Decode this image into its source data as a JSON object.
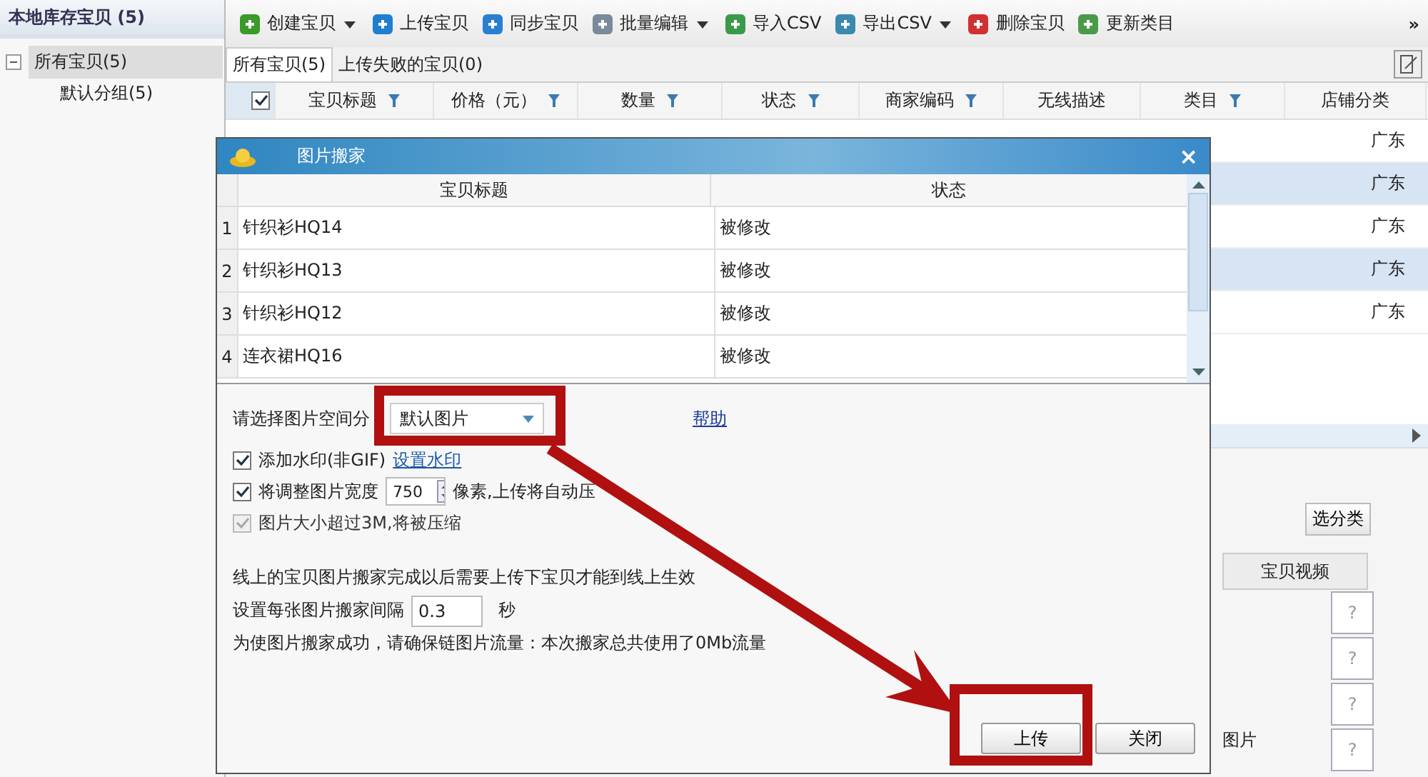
{
  "sidebar": {
    "title": "本地库存宝贝 (5)",
    "tree": [
      {
        "label": "所有宝贝(5)",
        "selected": true,
        "expanded": true,
        "children": [
          {
            "label": "默认分组(5)",
            "selected": false
          }
        ]
      }
    ]
  },
  "toolbar": {
    "items": [
      {
        "label": "创建宝贝",
        "dropdown": true
      },
      {
        "label": "上传宝贝",
        "dropdown": false
      },
      {
        "label": "同步宝贝",
        "dropdown": false
      },
      {
        "label": "批量编辑",
        "dropdown": true
      },
      {
        "label": "导入CSV",
        "dropdown": false
      },
      {
        "label": "导出CSV",
        "dropdown": true
      },
      {
        "label": "删除宝贝",
        "dropdown": false
      },
      {
        "label": "更新类目",
        "dropdown": false
      }
    ],
    "more": "»"
  },
  "tabs": [
    {
      "label": "所有宝贝(5)",
      "selected": true
    },
    {
      "label": "上传失败的宝贝(0)",
      "selected": false
    }
  ],
  "table": {
    "header_checked": true,
    "columns": [
      {
        "label": "宝贝标题",
        "filter": true
      },
      {
        "label": "价格（元）",
        "filter": true
      },
      {
        "label": "数量",
        "filter": true
      },
      {
        "label": "状态",
        "filter": true
      },
      {
        "label": "商家编码",
        "filter": true
      },
      {
        "label": "无线描述",
        "filter": false
      },
      {
        "label": "类目",
        "filter": true
      },
      {
        "label": "店铺分类",
        "filter": false
      }
    ],
    "rows": [
      {
        "column_9": "广东"
      },
      {
        "column_9": "广东"
      },
      {
        "column_9": "广东"
      },
      {
        "column_9": "广东"
      },
      {
        "column_9": "广东"
      }
    ]
  },
  "detail": {
    "category_button": "选分类",
    "media_tab": "宝贝视频",
    "image_label": "图片",
    "help_boxes": [
      "?",
      "?",
      "?",
      "?"
    ]
  },
  "dialog": {
    "title": "图片搬家",
    "close": "×",
    "columns": [
      "宝贝标题",
      "状态"
    ],
    "rows": [
      {
        "index": "1",
        "title": "针织衫HQ14",
        "status": "被修改"
      },
      {
        "index": "2",
        "title": "针织衫HQ13",
        "status": "被修改"
      },
      {
        "index": "3",
        "title": "针织衫HQ12",
        "status": "被修改"
      },
      {
        "index": "4",
        "title": "连衣裙HQ16",
        "status": "被修改"
      }
    ],
    "category": {
      "label": "请选择图片空间分",
      "value": "默认图片"
    },
    "help_link": "帮助",
    "options": [
      {
        "kind": "link",
        "label": "添加水印(非GIF)",
        "checked": true,
        "disabled": false,
        "link": "设置水印"
      },
      {
        "kind": "number",
        "label": "将调整图片宽度",
        "checked": true,
        "disabled": false,
        "value": "750",
        "suffix": "像素,上传将自动压"
      },
      {
        "kind": "plain",
        "label": "图片大小超过3M,将被压缩",
        "checked": true,
        "disabled": true
      }
    ],
    "note": "线上的宝贝图片搬家完成以后需要上传下宝贝才能到线上生效",
    "interval": {
      "label": "设置每张图片搬家间隔",
      "value": "0.3",
      "unit": "秒"
    },
    "usage": "为使图片搬家成功，请确保链图片流量：本次搬家总共使用了0Mb流量",
    "buttons": [
      "上传",
      "关闭"
    ]
  }
}
